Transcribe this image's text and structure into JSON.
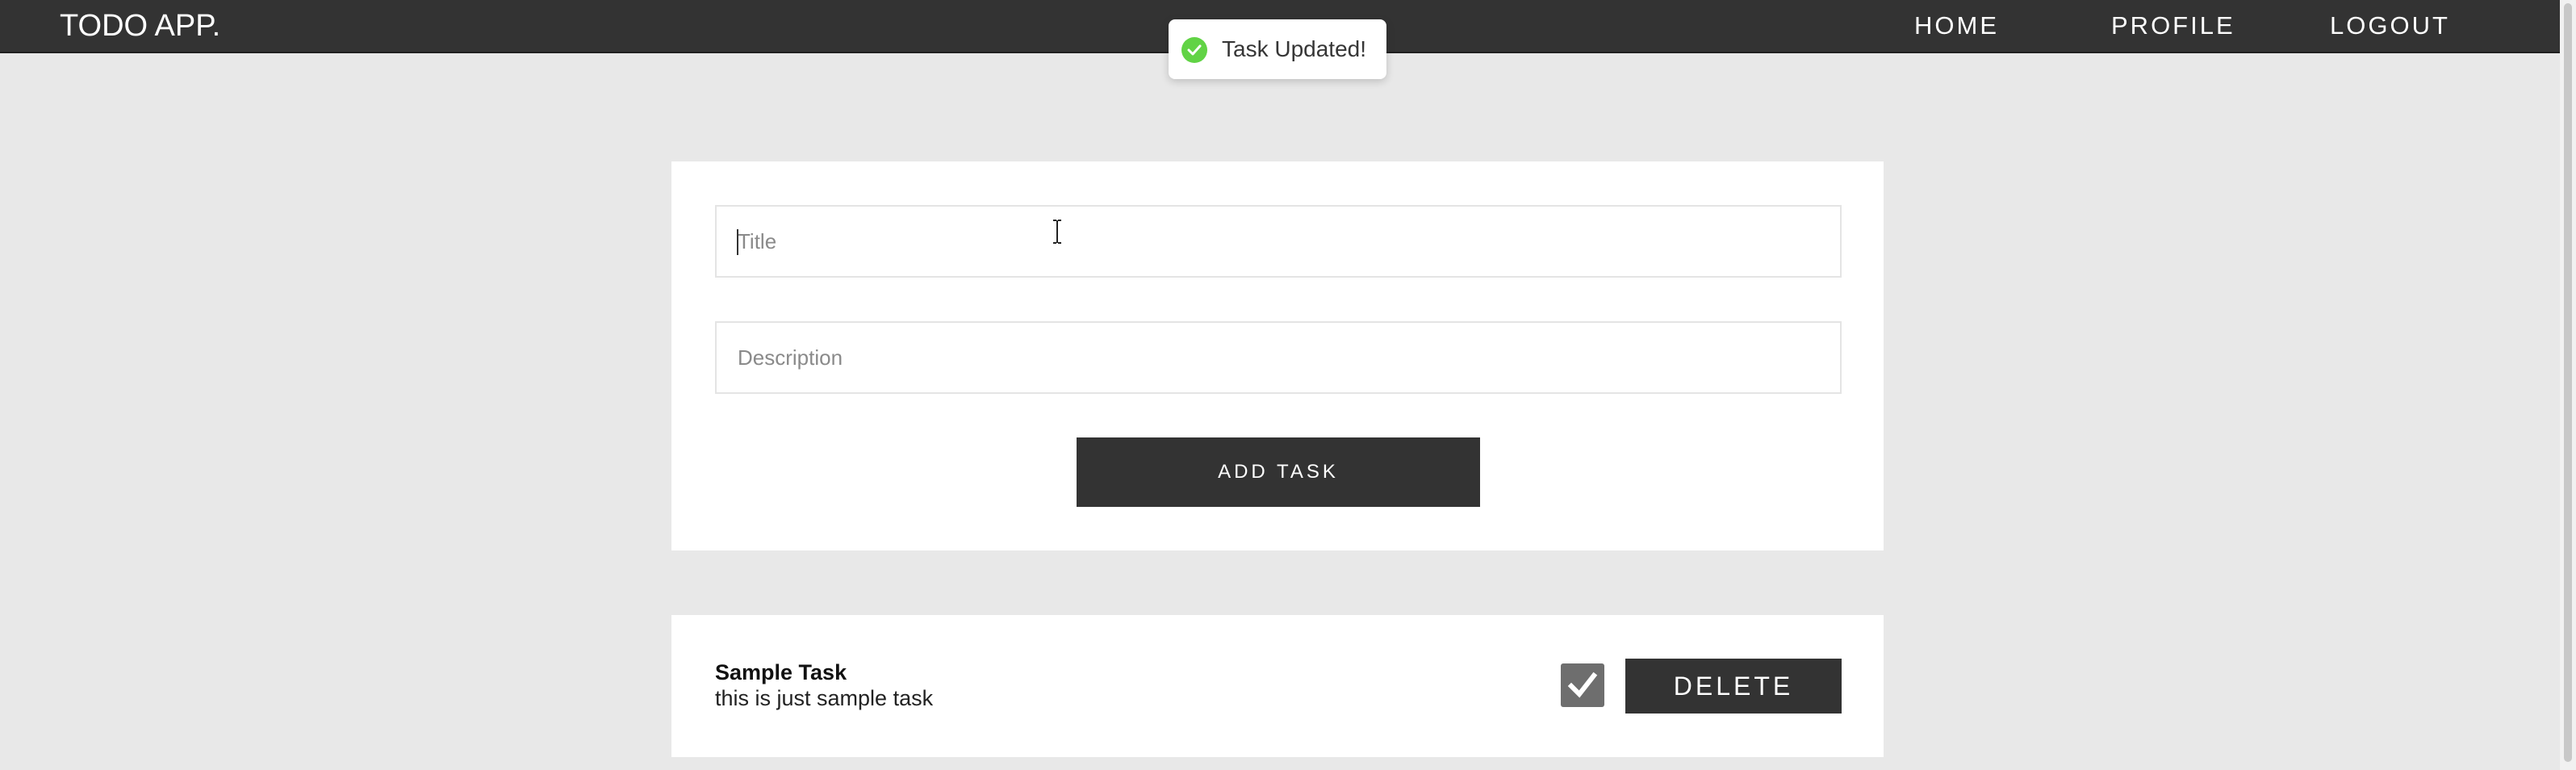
{
  "navbar": {
    "brand": "TODO APP.",
    "links": [
      "HOME",
      "PROFILE",
      "LOGOUT"
    ]
  },
  "toast": {
    "message": "Task Updated!",
    "icon": "check-circle-icon",
    "color": "#61d345"
  },
  "form": {
    "title_placeholder": "Title",
    "title_value": "",
    "description_placeholder": "Description",
    "description_value": "",
    "add_button_label": "ADD TASK"
  },
  "tasks": [
    {
      "title": "Sample Task",
      "description": "this is just sample task",
      "completed": true,
      "delete_label": "DELETE"
    }
  ],
  "colors": {
    "background": "#e8e8e8",
    "navbar": "#333333",
    "button": "#333333",
    "card": "#ffffff"
  }
}
